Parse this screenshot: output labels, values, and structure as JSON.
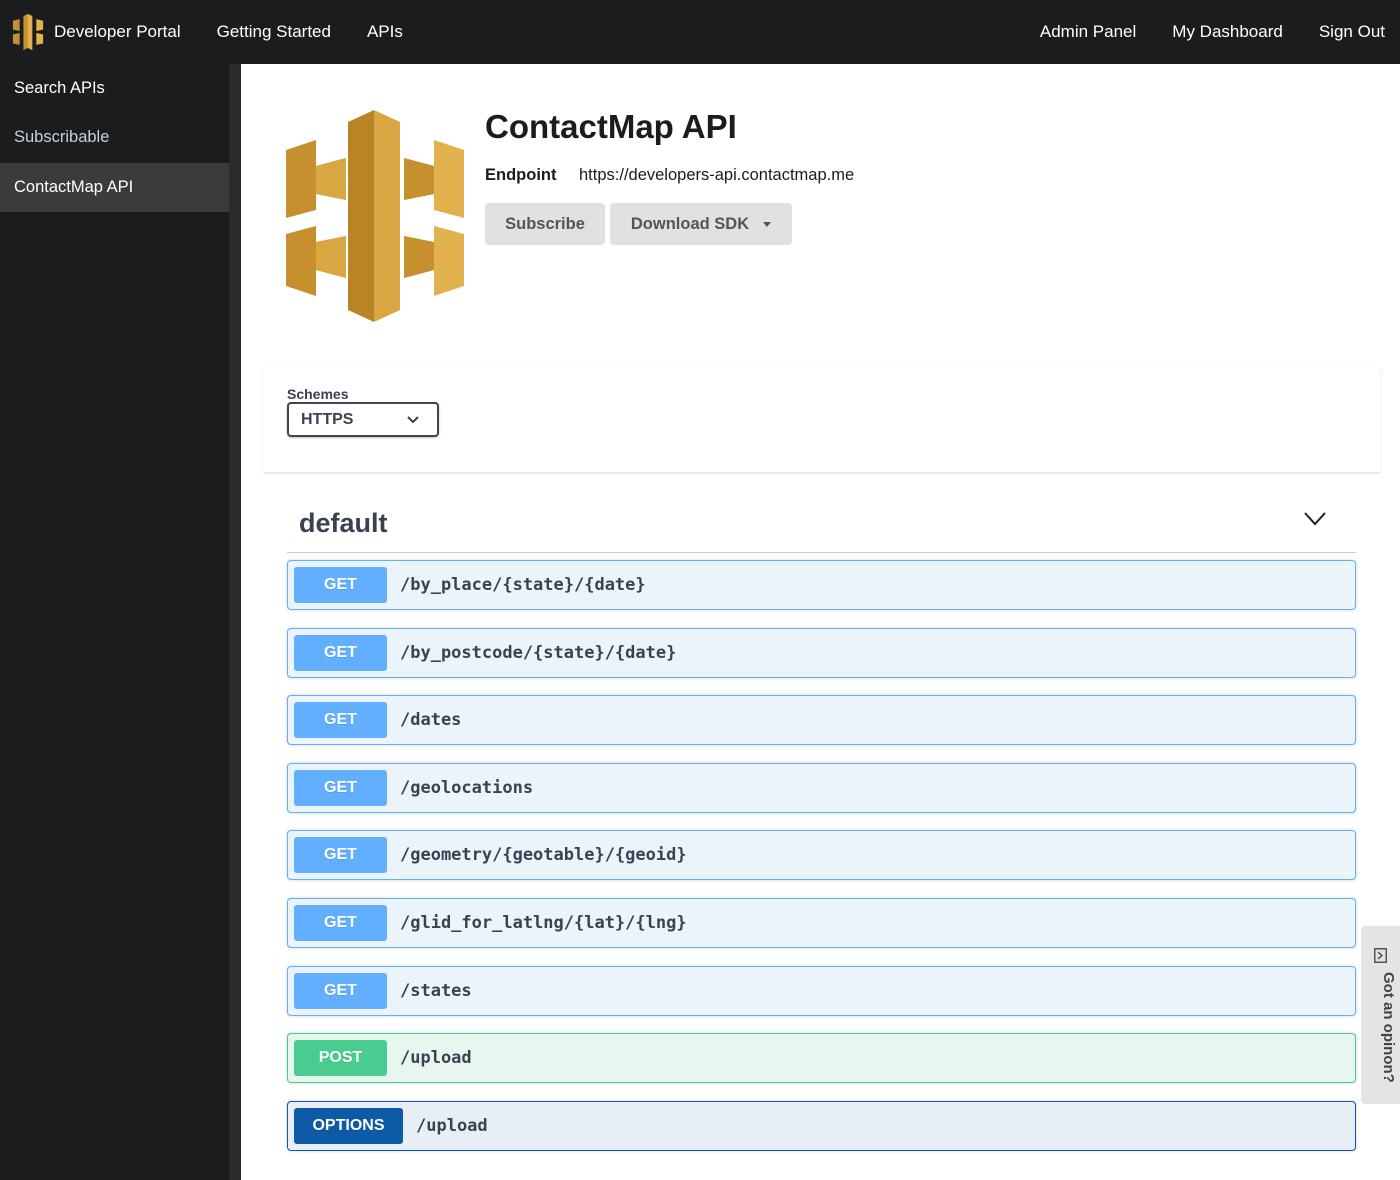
{
  "topbar": {
    "brand_label": "Developer Portal",
    "nav_left": [
      "Getting Started",
      "APIs"
    ],
    "nav_right": [
      "Admin Panel",
      "My Dashboard",
      "Sign Out"
    ]
  },
  "sidebar": {
    "items": [
      {
        "label": "Search APIs"
      },
      {
        "label": "Subscribable"
      },
      {
        "label": "ContactMap API"
      }
    ]
  },
  "api": {
    "title": "ContactMap API",
    "endpoint_label": "Endpoint",
    "endpoint_value": "https://developers-api.contactmap.me",
    "subscribe_label": "Subscribe",
    "sdk_label": "Download SDK"
  },
  "schemes": {
    "label": "Schemes",
    "selected": "HTTPS"
  },
  "section": {
    "title": "default"
  },
  "operations": [
    {
      "method": "GET",
      "path": "/by_place/{state}/{date}"
    },
    {
      "method": "GET",
      "path": "/by_postcode/{state}/{date}"
    },
    {
      "method": "GET",
      "path": "/dates"
    },
    {
      "method": "GET",
      "path": "/geolocations"
    },
    {
      "method": "GET",
      "path": "/geometry/{geotable}/{geoid}"
    },
    {
      "method": "GET",
      "path": "/glid_for_latlng/{lat}/{lng}"
    },
    {
      "method": "GET",
      "path": "/states"
    },
    {
      "method": "POST",
      "path": "/upload"
    },
    {
      "method": "OPTIONS",
      "path": "/upload"
    }
  ],
  "feedback": {
    "label": "Got an opinon?",
    "icon": "feedback-icon"
  },
  "colors": {
    "get": "#61affe",
    "post": "#49cc90",
    "options": "#0d5aa7",
    "logo": "#d9a741"
  }
}
